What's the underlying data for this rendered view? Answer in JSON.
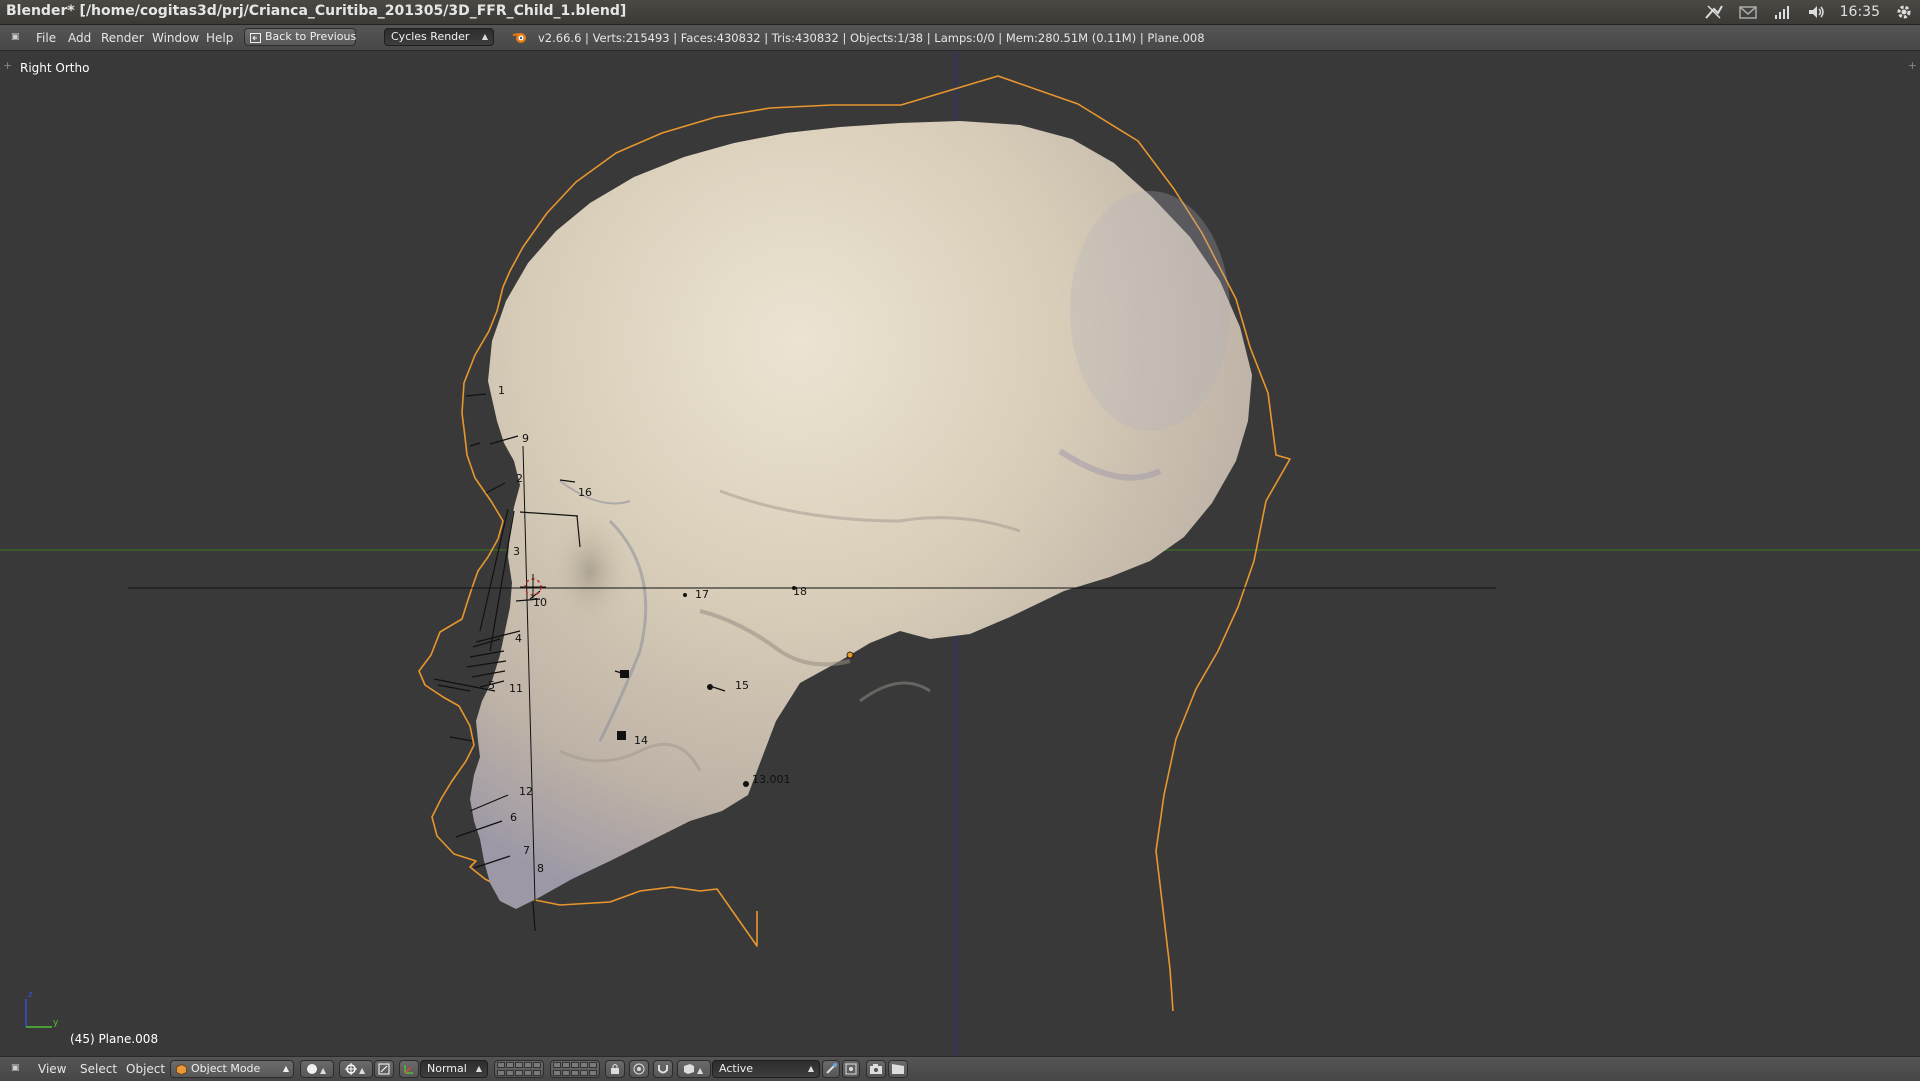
{
  "window": {
    "title": "Blender* [/home/cogitas3d/prj/Crianca_Curitiba_201305/3D_FFR_Child_1.blend]",
    "clock": "16:35"
  },
  "info_header": {
    "menus": [
      "File",
      "Add",
      "Render",
      "Window",
      "Help"
    ],
    "back_button": "Back to Previous",
    "render_engine": "Cycles Render",
    "stats": "v2.66.6 | Verts:215493 | Faces:430832 | Tris:430832 | Objects:1/38 | Lamps:0/0 | Mem:280.51M (0.11M) | Plane.008"
  },
  "viewport": {
    "view_name": "Right Ortho",
    "active_object": "(45) Plane.008",
    "landmark_labels": [
      "1",
      "9",
      "2",
      "16",
      "3",
      "10",
      "17",
      "18",
      "4",
      "5",
      "11",
      "15",
      "14",
      "13.001",
      "12",
      "6",
      "7",
      "8"
    ]
  },
  "footer": {
    "menus": [
      "View",
      "Select",
      "Object"
    ],
    "mode": "Object Mode",
    "pivot": "Normal",
    "layer_dropdown": "Active"
  },
  "colors": {
    "outline": "#e8962e",
    "skull": "#d9cfbb",
    "grid_x_axis": "#3d7a1f",
    "grid_z_axis": "#2a2a9a",
    "viewport_bg": "#393939"
  }
}
